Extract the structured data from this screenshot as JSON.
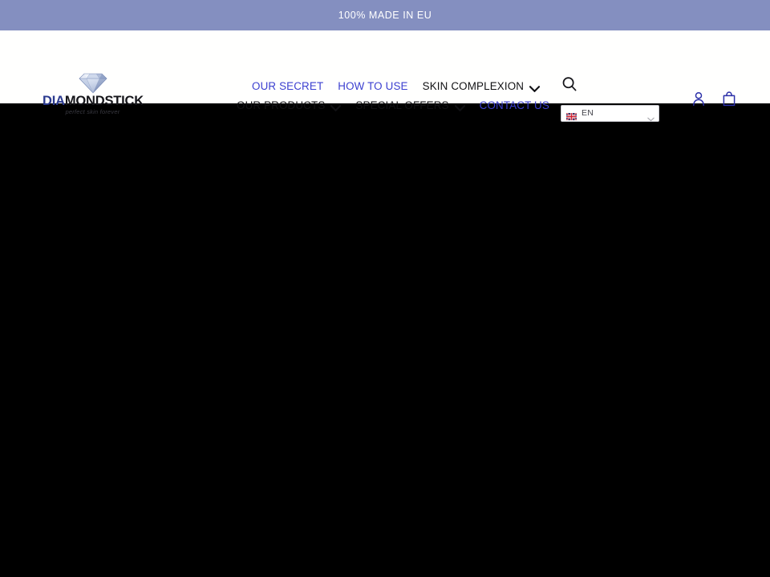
{
  "announcement": {
    "text": "100% MADE IN EU",
    "background_color": "#848FC0",
    "text_color": "#FFFFFF"
  },
  "header": {
    "background_color": "#FFFFFE",
    "logo": {
      "icon": "diamond-icon",
      "wordmark_prefix": "DIA",
      "wordmark_suffix": "MONDSTICK",
      "full_name": "DIAMONDSTICK",
      "tagline": "perfect skin forever",
      "prefix_color": "#2B3A8F",
      "suffix_color": "#16161B"
    },
    "nav": {
      "link_color": "#3B3FD0",
      "dark_color": "#111114",
      "rows": [
        [
          {
            "label": "OUR SECRET",
            "style": "link-blue",
            "has_caret": false,
            "name": "nav-item-our-secret"
          },
          {
            "label": "HOW TO USE",
            "style": "link-blue",
            "has_caret": false,
            "name": "nav-item-how-to-use"
          },
          {
            "label": "SKIN COMPLEXION",
            "style": "link-dark",
            "has_caret": true,
            "name": "nav-item-skin-complexion"
          }
        ],
        [
          {
            "label": "OUR PRODUCTS",
            "style": "link-dark",
            "has_caret": true,
            "name": "nav-item-our-products"
          },
          {
            "label": "SPECIAL OFFERS",
            "style": "link-dark",
            "has_caret": true,
            "name": "nav-item-special-offers"
          },
          {
            "label": "CONTACT US",
            "style": "link-blue",
            "has_caret": false,
            "name": "nav-item-contact-us"
          }
        ]
      ]
    },
    "search": {
      "icon": "search-icon",
      "aria_label": "Search"
    },
    "language_selector": {
      "icon": "uk-flag-icon",
      "selected": "EN",
      "caret": "chevron-down-icon"
    },
    "account": {
      "icon": "account-icon",
      "aria_label": "Log in"
    },
    "cart": {
      "icon": "cart-icon",
      "aria_label": "Cart"
    }
  },
  "main": {
    "background_color": "#000000",
    "content": ""
  }
}
